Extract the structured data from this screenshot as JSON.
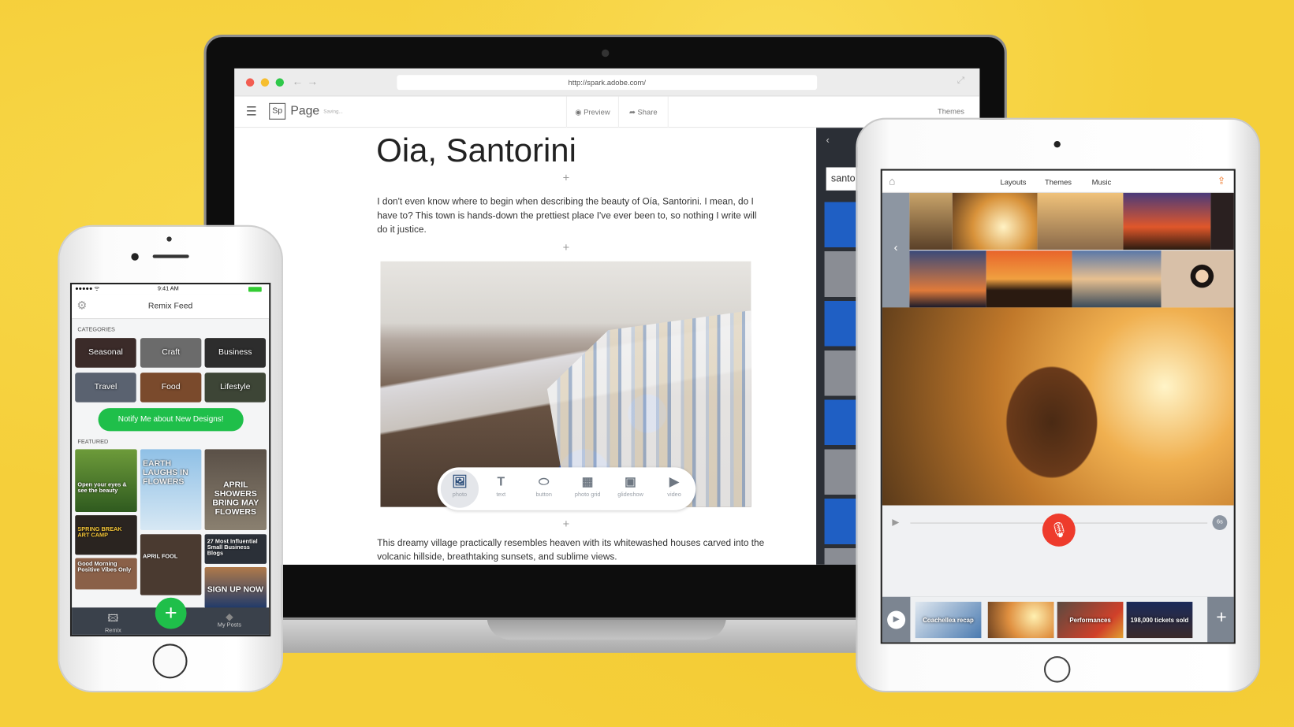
{
  "laptop": {
    "browser": {
      "url": "http://spark.adobe.com/",
      "dots": [
        "#f25d51",
        "#f6be2f",
        "#2fc84a"
      ]
    },
    "app": {
      "logo": "Sp",
      "name": "Page",
      "status": "Saving...",
      "preview": "Preview",
      "share": "Share",
      "themes": "Themes"
    },
    "doc": {
      "title": "Oia, Santorini",
      "para1": "I don't even know where to begin when describing the beauty of Oía, Santorini. I mean, do I have to? This town is hands-down the prettiest place I've ever been to, so nothing I write will do it justice.",
      "para2": "This dreamy village practically resembles heaven with its whitewashed houses carved into the volcanic hillside, breathtaking sunsets, and sublime views.",
      "plus": "+"
    },
    "toolbar": [
      {
        "label": "photo",
        "icon": "image-icon"
      },
      {
        "label": "text",
        "icon": "text-icon"
      },
      {
        "label": "button",
        "icon": "button-icon"
      },
      {
        "label": "photo grid",
        "icon": "photo-grid-icon"
      },
      {
        "label": "glideshow",
        "icon": "glideshow-icon"
      },
      {
        "label": "video",
        "icon": "video-icon"
      }
    ],
    "panel": {
      "search_value": "santo"
    }
  },
  "phone": {
    "status": {
      "time": "9:41 AM"
    },
    "title": "Remix Feed",
    "categories_label": "CATEGORIES",
    "categories": [
      "Seasonal",
      "Craft",
      "Business",
      "Travel",
      "Food",
      "Lifestyle"
    ],
    "notify_button": "Notify Me about New Designs!",
    "featured_label": "FEATURED",
    "featured": [
      "Open your eyes & see the beauty",
      "EARTH LAUGHS IN FLOWERS",
      "APRIL SHOWERS BRING MAY FLOWERS",
      "SPRING BREAK ART CAMP",
      "APRIL FOOL",
      "27 Most Influential Small Business Blogs",
      "Good Morning Positive Vibes Only",
      "SIGN UP NOW"
    ],
    "tabs": {
      "remix": "Remix",
      "add": "+",
      "my_posts": "My Posts"
    },
    "accent": "#1fbf4a"
  },
  "ipad": {
    "nav": [
      "Layouts",
      "Themes",
      "Music"
    ],
    "duration": "6s",
    "clips": [
      "Coachellea recap",
      "",
      "Performances",
      "198,000 tickets sold"
    ],
    "add": "+",
    "mic_color": "#ee3b2c",
    "share_color": "#f07a2c"
  }
}
